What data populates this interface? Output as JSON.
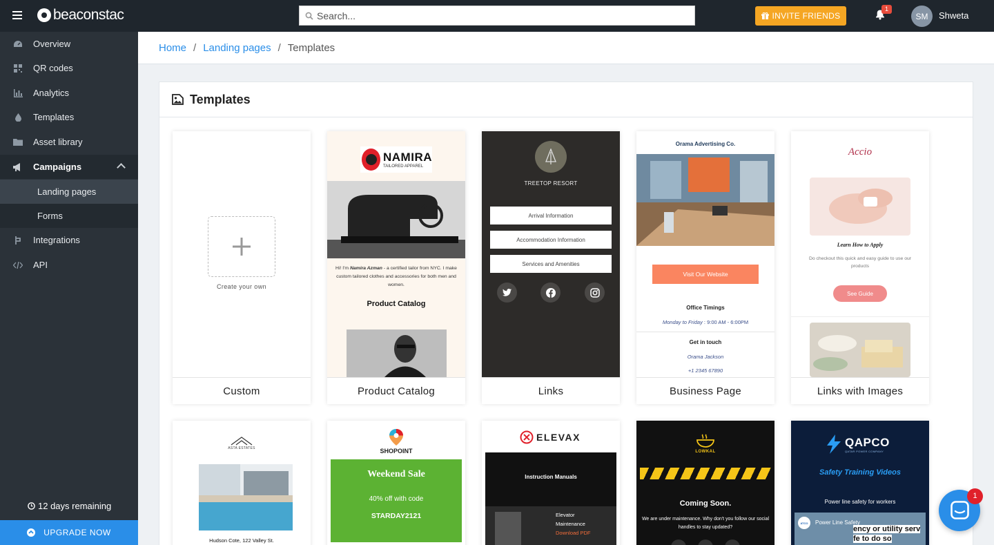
{
  "topbar": {
    "logo_text": "beaconstac",
    "search_placeholder": "Search...",
    "invite_label": "INVITE FRIENDS",
    "notification_count": "1",
    "avatar_initials": "SM",
    "username": "Shweta"
  },
  "sidebar": {
    "items": [
      {
        "label": "Overview",
        "icon": "dashboard-icon"
      },
      {
        "label": "QR codes",
        "icon": "qr-icon"
      },
      {
        "label": "Analytics",
        "icon": "bar-chart-icon"
      },
      {
        "label": "Templates",
        "icon": "drop-icon"
      },
      {
        "label": "Asset library",
        "icon": "folder-icon"
      },
      {
        "label": "Campaigns",
        "icon": "megaphone-icon"
      },
      {
        "label": "Landing pages"
      },
      {
        "label": "Forms"
      },
      {
        "label": "Integrations",
        "icon": "integration-icon"
      },
      {
        "label": "API",
        "icon": "code-icon"
      }
    ],
    "days_remaining": "12 days remaining",
    "upgrade_label": "UPGRADE NOW"
  },
  "breadcrumb": {
    "home": "Home",
    "landing_pages": "Landing pages",
    "current": "Templates"
  },
  "panel": {
    "title": "Templates"
  },
  "templates": {
    "row1": [
      {
        "caption": "Custom",
        "create_text": "Create your own"
      },
      {
        "caption": "Product Catalog",
        "brand": "NAMIRA",
        "brand_sub": "TAILORED APPAREL",
        "intro_a": "Hi! I'm ",
        "intro_name": "Namira Azman",
        "intro_b": " - a certified tailor from NYC. I make custom tailored clothes and accessories for both men and women.",
        "heading": "Product Catalog"
      },
      {
        "caption": "Links",
        "resort": "TREETOP RESORT",
        "links": [
          "Arrival Information",
          "Accommodation Information",
          "Services and Amenities"
        ]
      },
      {
        "caption": "Business Page",
        "company": "Orama Advertising Co.",
        "button": "Visit Our Website",
        "timings_title": "Office Timings",
        "timings_days": "Monday to Friday",
        "timings_hours": " : 9:00 AM - 6:00PM",
        "contact_title": "Get in touch",
        "contact_name": "Orama Jackson",
        "contact_phone": "+1 2345 67890"
      },
      {
        "caption": "Links with Images",
        "brand": "Accio",
        "heading": "Learn How to Apply",
        "body": "Do checkout this quick and easy guide to use our products",
        "button": "See Guide"
      }
    ],
    "row2": [
      {
        "brand": "ASTA ESTATES",
        "address": "Hudson Cote, 122 Valley St."
      },
      {
        "brand": "SHOPOINT",
        "sale_title": "Weekend Sale",
        "sale_line": "40% off with code",
        "sale_code": "STARDAY2121"
      },
      {
        "brand": "ELEVAX",
        "manuals": "Instruction Manuals",
        "item_a": "Elevator",
        "item_b": "Maintenance",
        "download": "Download PDF"
      },
      {
        "brand": "LOWKAL",
        "coming": "Coming Soon.",
        "note": "We are under maintenance. Why don't you follow our social handles to stay updated?"
      },
      {
        "brand": "QAPCO",
        "brand_sub": "QATAR POWER COMPANY",
        "heading": "Safety Training Videos",
        "sub": "Power line safety for workers",
        "video_title": "Power Line Safety",
        "video_caption_a": "ency or utility serv",
        "video_caption_b": "fe to do so"
      }
    ]
  },
  "chat": {
    "badge": "1"
  },
  "colors": {
    "topbar": "#1f262d",
    "sidebar": "#2b3239",
    "accent_blue": "#2a8ee8",
    "invite_orange": "#f5a623"
  }
}
